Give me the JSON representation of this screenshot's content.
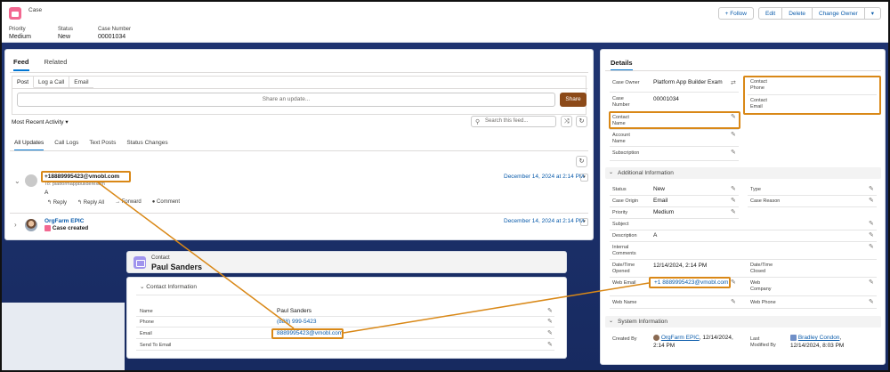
{
  "header": {
    "object_label": "Case",
    "fields": [
      {
        "label": "Priority",
        "value": "Medium"
      },
      {
        "label": "Status",
        "value": "New"
      },
      {
        "label": "Case Number",
        "value": "00001034"
      }
    ],
    "buttons": {
      "follow": "+ Follow",
      "edit": "Edit",
      "delete": "Delete",
      "change_owner": "Change Owner",
      "more": "▾"
    }
  },
  "feed": {
    "tabs": [
      "Feed",
      "Related"
    ],
    "publisher_tabs": [
      "Post",
      "Log a Call",
      "Email"
    ],
    "share_placeholder": "Share an update...",
    "share_button": "Share",
    "sort_label": "Most Recent Activity",
    "search_placeholder": "Search this feed...",
    "subtabs": [
      "All Updates",
      "Call Logs",
      "Text Posts",
      "Status Changes"
    ],
    "items": [
      {
        "author": "+18889995423@vmobl.com",
        "to": "To: platformappbuilderexam",
        "body": "A",
        "actions": [
          "↰ Reply",
          "↰ Reply All",
          "→ Forward",
          "● Comment"
        ],
        "date": "December 14, 2024 at 2:14 PM"
      },
      {
        "author": "OrgFarm EPIC",
        "body": "Case created",
        "date": "December 14, 2024 at 2:14 PM"
      }
    ]
  },
  "contact": {
    "kind": "Contact",
    "name": "Paul Sanders",
    "section": "Contact Information",
    "rows": [
      {
        "label": "Name",
        "value": "Paul Sanders"
      },
      {
        "label": "Phone",
        "value": "(888) 999-5423"
      },
      {
        "label": "Email",
        "value": "8889995423@vmobl.com"
      },
      {
        "label": "Send To Email",
        "value": ""
      }
    ]
  },
  "details": {
    "tab": "Details",
    "case_owner": {
      "label": "Case Owner",
      "value": "Platform App Builder Exam"
    },
    "case_number": {
      "label": "Case\nNumber",
      "value": "00001034"
    },
    "contact_name": {
      "label": "Contact\nName",
      "value": ""
    },
    "account_name": {
      "label": "Account\nName",
      "value": ""
    },
    "subscription": {
      "label": "Subscription",
      "value": ""
    },
    "contact_phone": {
      "label": "Contact\nPhone",
      "value": ""
    },
    "contact_email": {
      "label": "Contact\nEmail",
      "value": ""
    },
    "additional_section": "Additional Information",
    "additional_left": [
      {
        "label": "Status",
        "value": "New"
      },
      {
        "label": "Case Origin",
        "value": "Email"
      },
      {
        "label": "Priority",
        "value": "Medium"
      },
      {
        "label": "Subject",
        "value": ""
      },
      {
        "label": "Description",
        "value": "A"
      },
      {
        "label": "Internal\nComments",
        "value": ""
      },
      {
        "label": "Date/Time\nOpened",
        "value": "12/14/2024, 2:14 PM"
      },
      {
        "label": "Web Email",
        "value": "+1 8889995423@vmobl.com"
      },
      {
        "label": "Web Name",
        "value": ""
      }
    ],
    "additional_right": [
      {
        "label": "Type",
        "value": ""
      },
      {
        "label": "Case Reason",
        "value": ""
      },
      {
        "label": "Date/Time\nClosed",
        "value": ""
      },
      {
        "label": "Web\nCompany",
        "value": ""
      },
      {
        "label": "Web Phone",
        "value": ""
      }
    ],
    "system_section": "System Information",
    "created_by": {
      "label": "Created By",
      "user": "OrgFarm EPIC",
      "date": ", 12/14/2024,",
      "time": "2:14 PM"
    },
    "modified_by": {
      "label": "Last\nModified By",
      "user": "Bradley Condon",
      "date": "12/14/2024, 8:03 PM"
    }
  },
  "colors": {
    "highlight": "#d98817",
    "brand": "#0176d3",
    "share": "#8c4a19"
  }
}
